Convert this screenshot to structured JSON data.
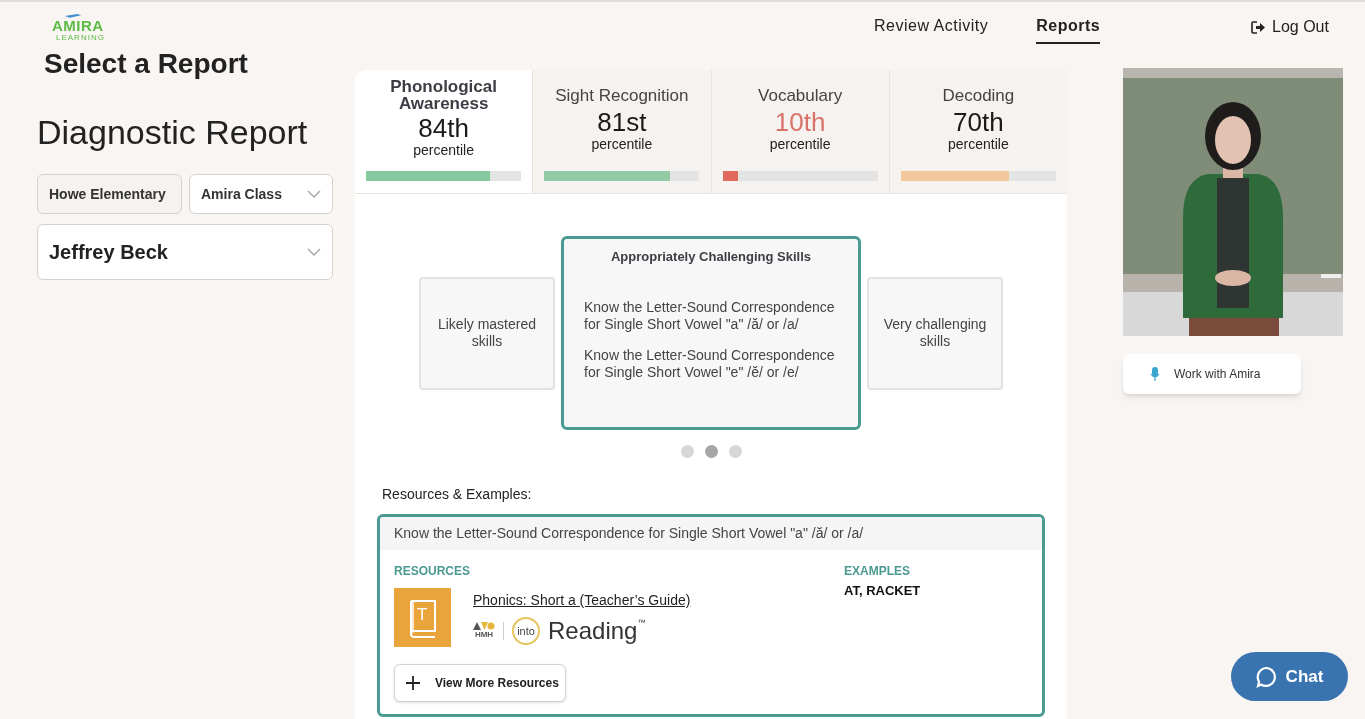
{
  "logo": {
    "name": "AMIRA",
    "tagline": "LEARNING"
  },
  "nav": [
    {
      "label": "Review Activity",
      "selected": false
    },
    {
      "label": "Reports",
      "selected": true
    }
  ],
  "logout": "Log Out",
  "page_title": "Select a Report",
  "report_title": "Diagnostic Report",
  "filters": [
    {
      "kind": "plain",
      "value": "Howe Elementary"
    },
    {
      "kind": "dropdown",
      "value": "Amira Class"
    }
  ],
  "student": {
    "value": "Jeffrey Beck"
  },
  "tabs": [
    {
      "label": "Phonological Awareness",
      "value": "84th",
      "unit": "percentile",
      "level": 0.8,
      "color": "#86c9a0",
      "alert": false,
      "selected": true
    },
    {
      "label": "Sight Recognition",
      "value": "81st",
      "unit": "percentile",
      "level": 0.81,
      "color": "#93c9a4",
      "alert": false,
      "selected": false
    },
    {
      "label": "Vocabulary",
      "value": "10th",
      "unit": "percentile",
      "level": 0.1,
      "color": "#e0695c",
      "alert": true,
      "selected": false
    },
    {
      "label": "Decoding",
      "value": "70th",
      "unit": "percentile",
      "level": 0.7,
      "color": "#f3c99c",
      "alert": false,
      "selected": false
    }
  ],
  "skill_cards": [
    {
      "label": "Likely mastered skills",
      "selected": false
    },
    {
      "label": "Appropriately Challenging Skills",
      "selected": true,
      "skills": [
        "Know the Letter-Sound Correspondence for Single Short Vowel \"a\" /ă/ or /a/",
        "Know the Letter-Sound Correspondence for Single Short Vowel \"e\" /ĕ/ or /e/"
      ]
    },
    {
      "label": "Very challenging skills",
      "selected": false
    }
  ],
  "carousel_dots": [
    {
      "selected": false
    },
    {
      "selected": true
    },
    {
      "selected": false
    }
  ],
  "resources_heading": "Resources & Examples:",
  "resource_box": {
    "skill": "Know the Letter-Sound Correspondence for Single Short Vowel \"a\" /ă/ or /a/",
    "resources_label": "RESOURCES",
    "book_letter": "T",
    "resource_link": "Phonics: Short a (Teacher’s Guide)",
    "publisher": "HMH",
    "brand_into": "into",
    "brand_name": "Reading",
    "brand_mark": "™",
    "examples_label": "EXAMPLES",
    "examples": "AT, RACKET",
    "more_button": "View More Resources"
  },
  "work_button": "Work with Amira",
  "chat_button": "Chat"
}
